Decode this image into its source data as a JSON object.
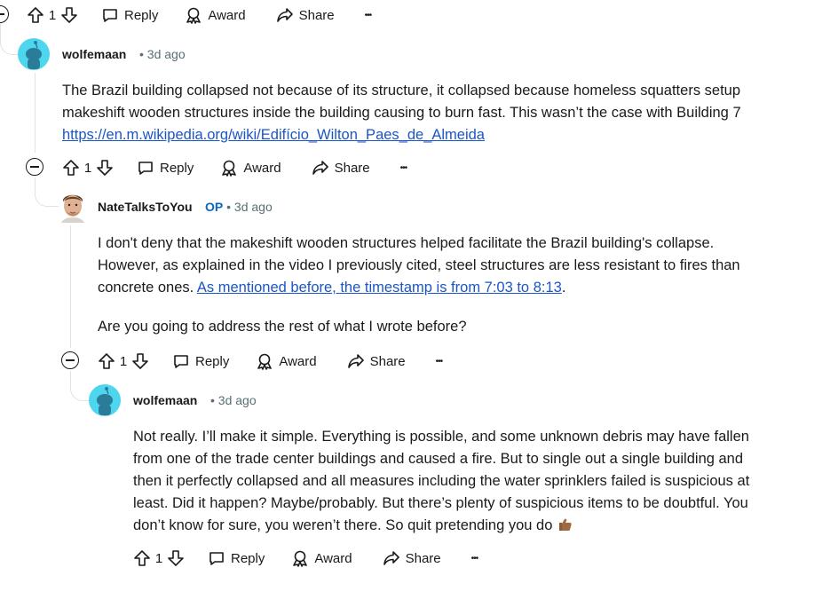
{
  "comments": [
    {
      "author": "wolfemaan",
      "time": "3d ago",
      "text_line1": "The Brazil building collapsed not because of its structure, it collapsed because homeless squatters setup",
      "text_line2": "makeshift wooden structures inside the building causing to burn fast. This wasn’t the case with Building 7",
      "link": "https://en.m.wikipedia.org/wiki/Edifício_Wilton_Paes_de_Almeida"
    },
    {
      "author": "NateTalksToYou",
      "op_label": "OP",
      "time": "3d ago",
      "para1_line1": "I don't deny that the makeshift wooden structures helped facilitate the Brazil building's collapse.",
      "para1_line2": "However, as explained in the video I previously cited, steel structures are less resistant to fires than",
      "para1_line3_pre": "concrete ones. ",
      "para1_link": "As mentioned before, the timestamp is from 7:03 to 8:13",
      "para1_line3_post": ".",
      "para2": "Are you going to address the rest of what I wrote before?"
    },
    {
      "author": "wolfemaan",
      "time": "3d ago",
      "line1": "Not really. I’ll make it simple. Everything is possible, and some unknown debris may have fallen",
      "line2": "from one of the trade center buildings and caused a fire. But to single out a single building and",
      "line3": "then it perfectly collapsed and all measures including the water sprinklers failed is suspicious at",
      "line4": "least. Did it happen? Maybe/probably. But there’s plenty of suspicious items to be doubtful. You",
      "line5": "don’t know for sure, you weren’t there. So quit pretending you do"
    }
  ],
  "actions": {
    "vote_count": "1",
    "reply_label": "Reply",
    "award_label": "Award",
    "share_label": "Share",
    "more_label": "•••"
  },
  "meta_separator": "•",
  "colors": {
    "snoo_bg": "#4fd6ef",
    "snoo_body": "#2a7c99",
    "link": "#1a56c5",
    "op": "#0a66c2",
    "meta": "#576f76"
  }
}
